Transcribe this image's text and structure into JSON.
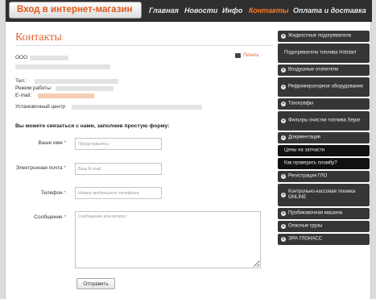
{
  "header": {
    "store_label": "Вход в интернет-магазин",
    "nav": [
      {
        "label": "Главная",
        "active": false
      },
      {
        "label": "Новости",
        "active": false
      },
      {
        "label": "Инфо",
        "active": false
      },
      {
        "label": "Контакты",
        "active": true
      },
      {
        "label": "Оплата и доставка",
        "active": false
      }
    ]
  },
  "page": {
    "title": "Контакты",
    "print_label": "Печать",
    "company_prefix": "ООО",
    "phone_label": "Тел.:",
    "hours_label": "Режим работы:",
    "email_label": "E-mail:",
    "center_label": "Установочный центр"
  },
  "form": {
    "intro": "Вы можете связаться с нами, заполнив простую форму:",
    "name_label": "Ваше имя",
    "name_placeholder": "Представьтесь",
    "email_label": "Электронная почта",
    "email_placeholder": "Ваш E-mail",
    "phone_label": "Телефон",
    "phone_placeholder": "Номер мобильного телефона",
    "message_label": "Сообщение",
    "message_placeholder": "Сообщение или вопрос",
    "required_mark": "*",
    "submit_label": "Отправить"
  },
  "sidebar": {
    "items": [
      {
        "label": "Жидкостные подогреватели",
        "bullet": true,
        "bullet_glyph": "+"
      },
      {
        "label": "Подогреватели топлива Hotstart",
        "bullet": false,
        "bullet_glyph": ""
      },
      {
        "label": "Воздушные отопители",
        "bullet": true,
        "bullet_glyph": "+"
      },
      {
        "label": "Рефрижераторное оборудование",
        "bullet": true,
        "bullet_glyph": "+"
      },
      {
        "label": "Тахографы",
        "bullet": true,
        "bullet_glyph": "+"
      },
      {
        "label": "Фильтры очистки топлива Separ",
        "bullet": true,
        "bullet_glyph": "+"
      },
      {
        "label": "Документация",
        "bullet": true,
        "bullet_glyph": "+"
      },
      {
        "label": "Цены на запчасти",
        "bullet": false,
        "bullet_glyph": ""
      },
      {
        "label": "Как проверить пломбу?",
        "bullet": false,
        "bullet_glyph": ""
      },
      {
        "label": "Регистрация ГЛО",
        "bullet": true,
        "bullet_glyph": "+"
      },
      {
        "label": "Контрольно-кассовая техника ONLINE",
        "bullet": true,
        "bullet_glyph": "+"
      },
      {
        "label": "Пробиковочная машина",
        "bullet": true,
        "bullet_glyph": "+"
      },
      {
        "label": "Опасные грузы",
        "bullet": true,
        "bullet_glyph": "+"
      },
      {
        "label": "ЭРА ГЛОНАСС",
        "bullet": true,
        "bullet_glyph": "+"
      }
    ]
  },
  "colors": {
    "accent": "#e2632a",
    "nav_bg": "#2f2f2f",
    "sidebar_bg": "#363636"
  }
}
